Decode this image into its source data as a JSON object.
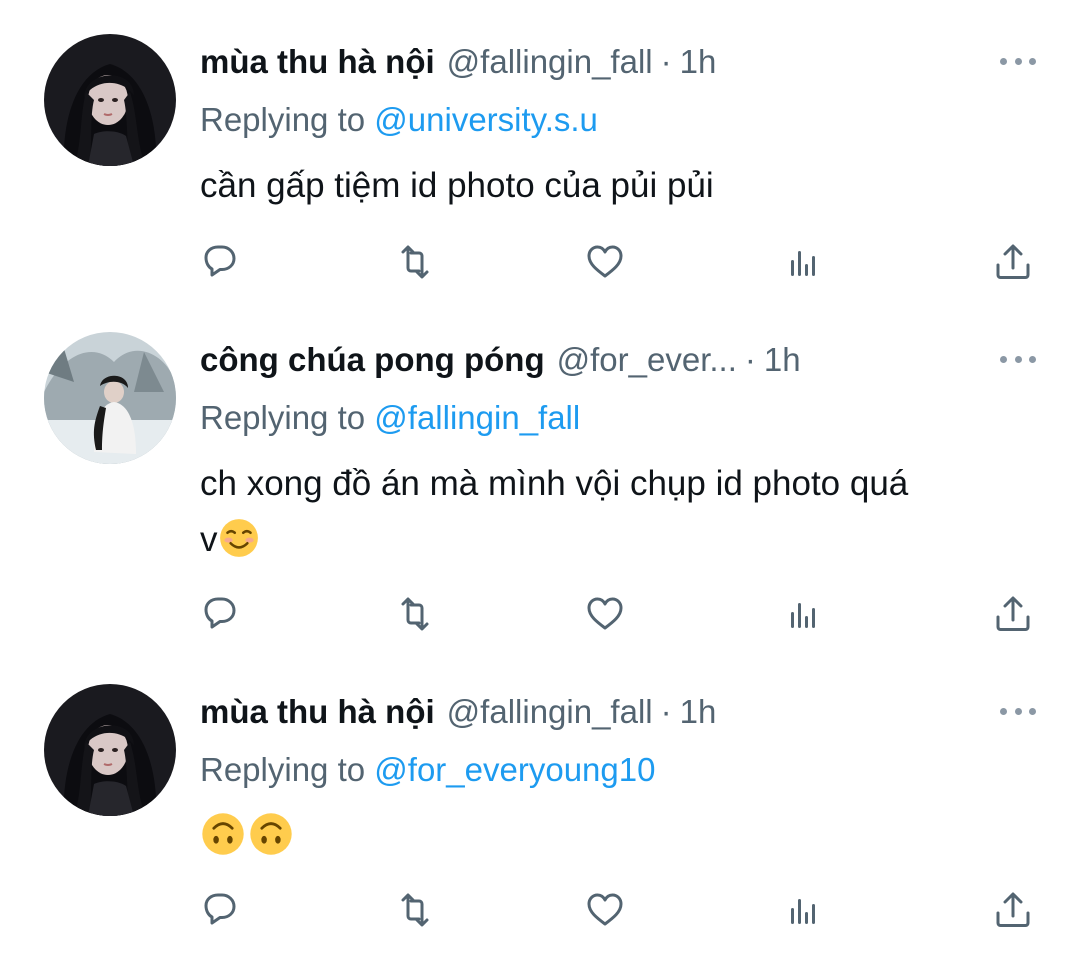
{
  "colors": {
    "text": "#0f1419",
    "secondary": "#536471",
    "link": "#1d9bf0",
    "icon": "#536471"
  },
  "tweets": [
    {
      "name": "mùa thu hà nội",
      "handle": "@fallingin_fall",
      "separator": "·",
      "time": "1h",
      "replying_prefix": "Replying to",
      "replying_to": "@university.s.u",
      "text": "cần gấp tiệm id photo của pủi pủi",
      "emojis": [],
      "avatar_icon": "avatar-dark-hair-girl"
    },
    {
      "name": "công chúa pong póng",
      "handle": "@for_ever...",
      "separator": "·",
      "time": "1h",
      "replying_prefix": "Replying to",
      "replying_to": "@fallingin_fall",
      "text_line1": "ch xong đồ án mà mình vội chụp id photo quá",
      "text_line2": "v",
      "emojis": [
        "smiling-face-emoji"
      ],
      "avatar_icon": "avatar-snow-scene"
    },
    {
      "name": "mùa thu hà nội",
      "handle": "@fallingin_fall",
      "separator": "·",
      "time": "1h",
      "replying_prefix": "Replying to",
      "replying_to": "@for_everyoung10",
      "text": "",
      "emojis": [
        "upside-down-face-emoji",
        "upside-down-face-emoji"
      ],
      "avatar_icon": "avatar-dark-hair-girl"
    }
  ],
  "action_icons": [
    "reply-icon",
    "retweet-icon",
    "like-icon",
    "views-icon",
    "share-icon"
  ]
}
